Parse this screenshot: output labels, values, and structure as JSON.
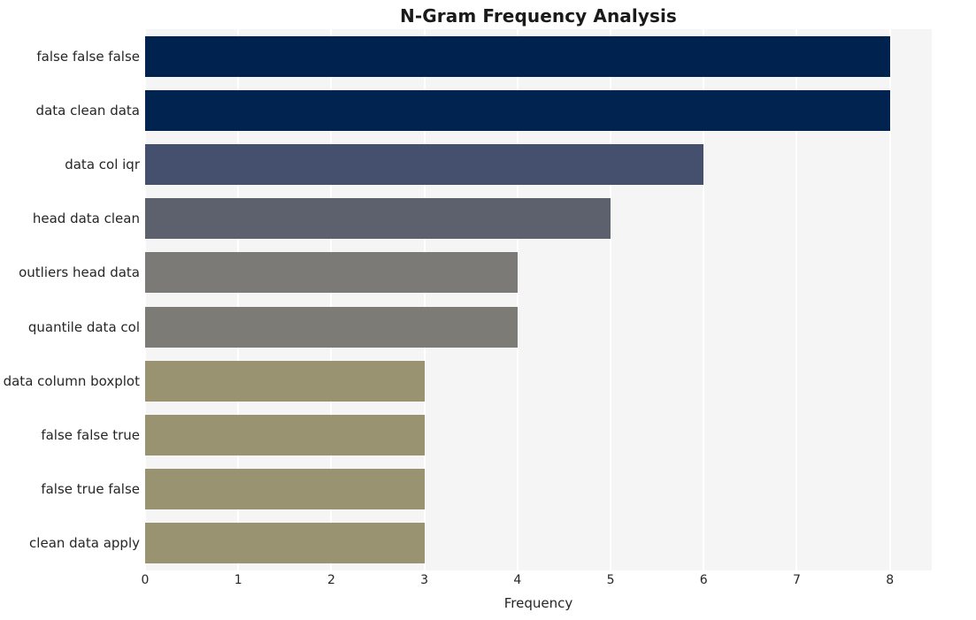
{
  "chart_data": {
    "type": "bar",
    "orientation": "horizontal",
    "title": "N-Gram Frequency Analysis",
    "xlabel": "Frequency",
    "ylabel": "",
    "categories": [
      "false false false",
      "data clean data",
      "data col iqr",
      "head data clean",
      "outliers head data",
      "quantile data col",
      "data column boxplot",
      "false false true",
      "false true false",
      "clean data apply"
    ],
    "values": [
      8,
      8,
      6,
      5,
      4,
      4,
      3,
      3,
      3,
      3
    ],
    "bar_colors": [
      "#00224e",
      "#00234f",
      "#44506d",
      "#5d616e",
      "#7b7a77",
      "#7c7b76",
      "#9a9372",
      "#9a9372",
      "#9a9372",
      "#9a9372"
    ],
    "xlim": [
      0,
      8.45
    ],
    "xticks": [
      0,
      1,
      2,
      3,
      4,
      5,
      6,
      7,
      8
    ],
    "xticklabels": [
      "0",
      "1",
      "2",
      "3",
      "4",
      "5",
      "6",
      "7",
      "8"
    ],
    "grid": "vertical",
    "grid_color": "#ffffff",
    "plot_background": "#f5f5f6",
    "figure_background": "#ffffff",
    "legend": null,
    "colormap": "cividis"
  }
}
